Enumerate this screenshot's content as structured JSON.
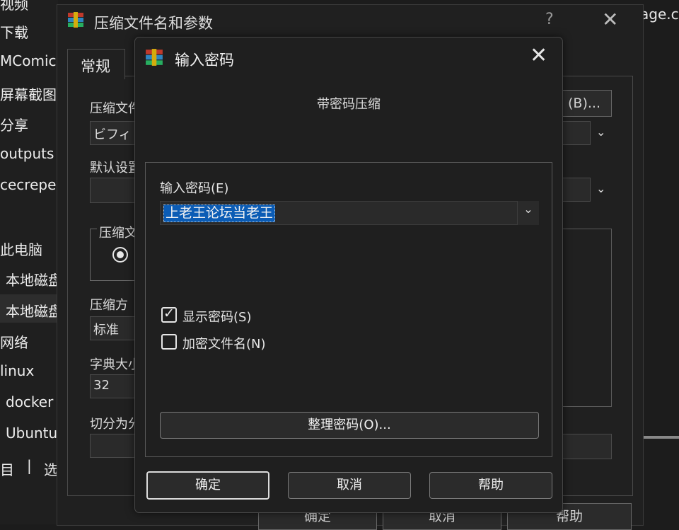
{
  "explorer": {
    "sidebar_items": [
      "视频",
      "下载",
      "MComic",
      "屏幕截图",
      "分享",
      "outputs",
      "cecrepe",
      "此电脑",
      "本地磁盘",
      "本地磁盘",
      "网络",
      "linux",
      "docker",
      "Ubuntu"
    ],
    "status_left": "目",
    "status_sep": "|",
    "status_right": "选",
    "right_text": "age.c"
  },
  "back_window": {
    "title": "压缩文件名和参数",
    "help": "?",
    "close": "✕",
    "tab_general": "常规",
    "archive_name_label": "压缩文件",
    "archive_name_value": "ビフィ",
    "browse_button": "(B)...",
    "default_profile_label": "默认设置",
    "format_group_label": "压缩文",
    "method_label": "压缩方",
    "method_value": "标准",
    "dict_label": "字典大小",
    "dict_value": "32",
    "split_label": "切分为分",
    "ok": "确定",
    "cancel": "取消",
    "help_btn": "帮助"
  },
  "dialog": {
    "title": "输入密码",
    "subtitle": "带密码压缩",
    "password_label": "输入密码(E)",
    "password_value": "上老王论坛当老王",
    "show_password_label": "显示密码(S)",
    "show_password_checked": true,
    "encrypt_names_label": "加密文件名(N)",
    "encrypt_names_checked": false,
    "organize_button": "整理密码(O)...",
    "ok_button": "确定",
    "cancel_button": "取消",
    "help_button": "帮助"
  }
}
